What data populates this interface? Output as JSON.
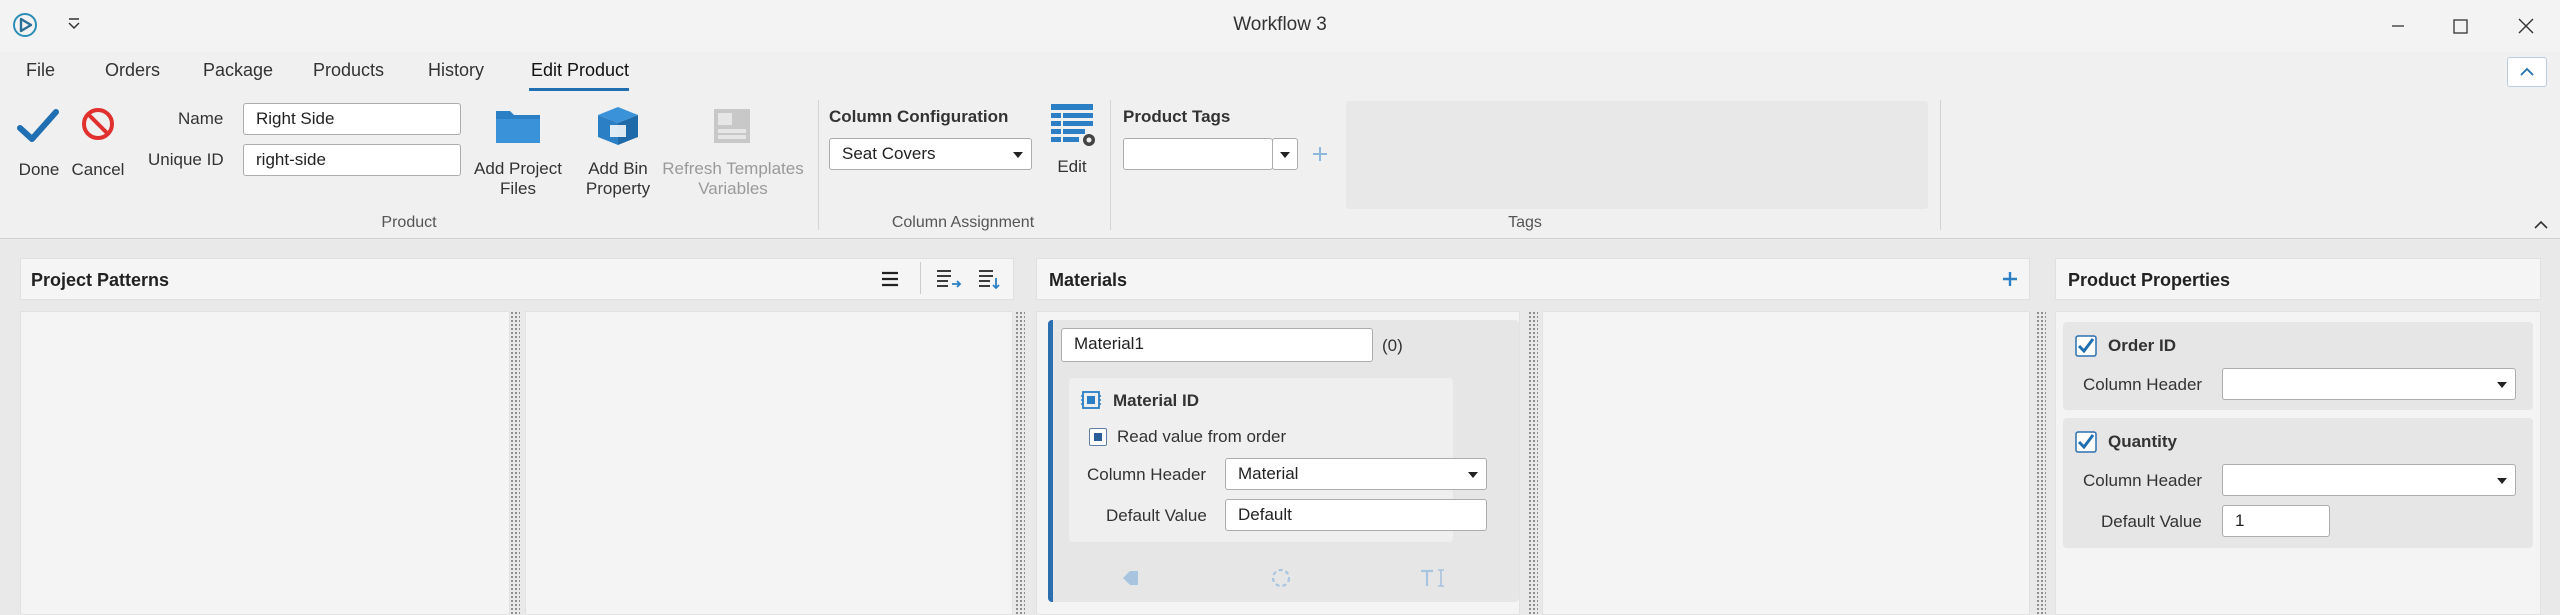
{
  "window": {
    "title": "Workflow 3",
    "icons": {
      "app": "app-logo-icon",
      "quick_access": "chevron-down-icon",
      "minimize": "minimize-icon",
      "maximize": "maximize-icon",
      "close": "close-icon"
    }
  },
  "menu": {
    "tabs": [
      {
        "label": "File"
      },
      {
        "label": "Orders"
      },
      {
        "label": "Package"
      },
      {
        "label": "Products"
      },
      {
        "label": "History"
      },
      {
        "label": "Edit Product",
        "active": true
      }
    ],
    "accent": "#1f6fb2"
  },
  "ribbon": {
    "done_label": "Done",
    "cancel_label": "Cancel",
    "name_label": "Name",
    "name_value": "Right Side",
    "unique_id_label": "Unique ID",
    "unique_id_value": "right-side",
    "add_project_files_label_1": "Add Project",
    "add_project_files_label_2": "Files",
    "add_bin_property_label_1": "Add Bin",
    "add_bin_property_label_2": "Property",
    "refresh_templates_label_1": "Refresh Templates",
    "refresh_templates_label_2": "Variables",
    "product_group": "Product",
    "column_config_title": "Column Configuration",
    "column_config_value": "Seat Covers",
    "edit_label": "Edit",
    "column_assignment_group": "Column Assignment",
    "product_tags_title": "Product Tags",
    "tags_dropdown_value": "",
    "tags_group": "Tags"
  },
  "panels": {
    "project_patterns": {
      "title": "Project Patterns"
    },
    "materials": {
      "title": "Materials",
      "material": {
        "name": "Material1",
        "count": "(0)",
        "id_title": "Material ID",
        "read_from_order": "Read value from order",
        "column_header_label": "Column Header",
        "column_header_value": "Material",
        "default_value_label": "Default Value",
        "default_value": "Default"
      }
    },
    "product_properties": {
      "title": "Product Properties",
      "order_id": {
        "title": "Order ID",
        "checked": true,
        "column_header_label": "Column Header",
        "column_header_value": ""
      },
      "quantity": {
        "title": "Quantity",
        "checked": true,
        "column_header_label": "Column Header",
        "column_header_value": "",
        "default_value_label": "Default Value",
        "default_value": "1"
      }
    }
  }
}
